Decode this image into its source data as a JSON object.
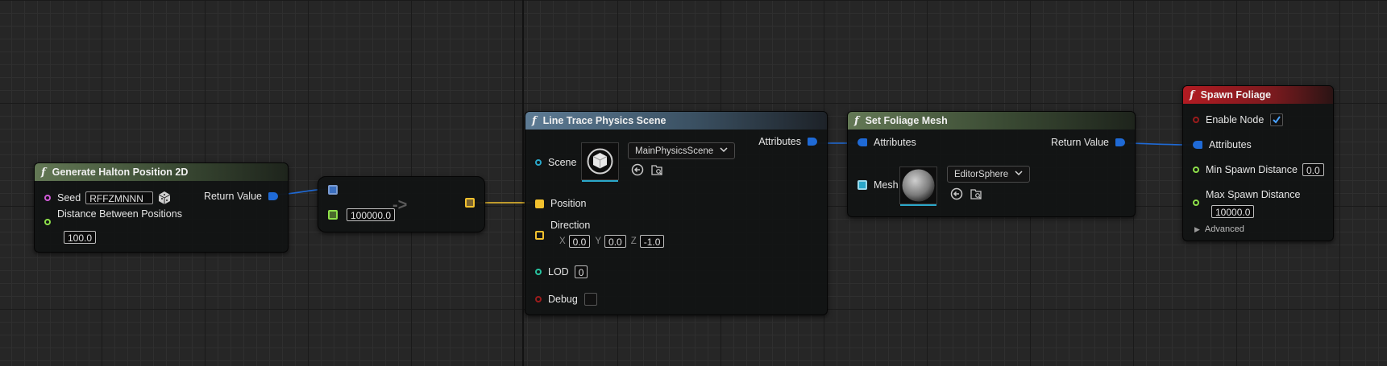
{
  "nodes": {
    "halton": {
      "title": "Generate Halton Position 2D",
      "seed_label": "Seed",
      "seed_value": "RFFZMNNN",
      "return_label": "Return Value",
      "distance_label": "Distance Between Positions",
      "distance_value": "100.0"
    },
    "reroute": {
      "arrow": "->",
      "value": "100000.0"
    },
    "line_trace": {
      "title": "Line Trace Physics Scene",
      "scene_label": "Scene",
      "scene_value": "MainPhysicsScene",
      "attributes_label": "Attributes",
      "position_label": "Position",
      "direction_label": "Direction",
      "x_label": "X",
      "x_value": "0.0",
      "y_label": "Y",
      "y_value": "0.0",
      "z_label": "Z",
      "z_value": "-1.0",
      "lod_label": "LOD",
      "lod_value": "0",
      "debug_label": "Debug"
    },
    "set_foliage": {
      "title": "Set Foliage Mesh",
      "attributes_label": "Attributes",
      "return_label": "Return Value",
      "mesh_label": "Mesh",
      "mesh_value": "EditorSphere"
    },
    "spawn": {
      "title": "Spawn Foliage",
      "enable_label": "Enable Node",
      "enable_checked": true,
      "attributes_label": "Attributes",
      "min_label": "Min Spawn Distance",
      "min_value": "0.0",
      "max_label": "Max Spawn Distance",
      "max_value": "10000.0",
      "advanced_label": "Advanced"
    }
  },
  "icons": {
    "function": "f",
    "dice": "dice-icon",
    "browse": "browse-icon",
    "use_selected": "use-selected-icon",
    "chevron": "chevron-down-icon",
    "expand": "expand-triangle-icon"
  },
  "colors": {
    "background": "#262626",
    "vector_pin": "#f2c12e",
    "struct_pin": "#1f6ad6",
    "int_pin": "#28c3a0",
    "float_pin": "#8ee04a",
    "bool_pin": "#9a1c1c",
    "string_pin": "#d15bd8",
    "object_pin": "#2aa7c9"
  }
}
